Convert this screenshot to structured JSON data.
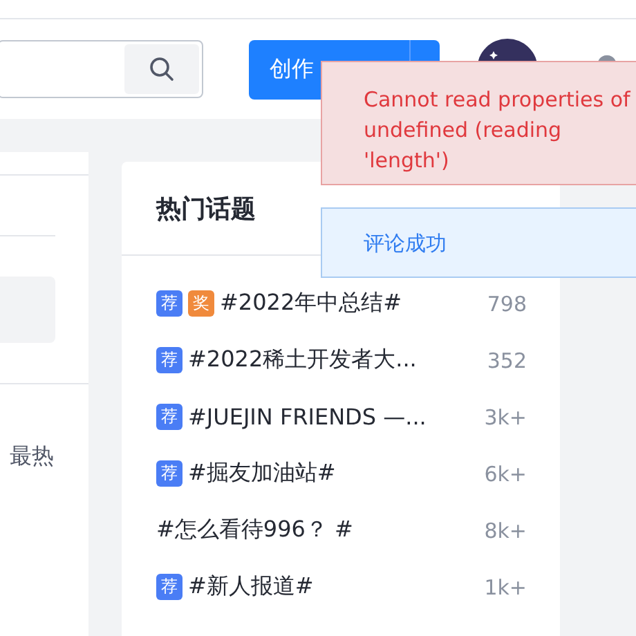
{
  "header": {
    "create_button": {
      "label": "创作"
    }
  },
  "left_panel": {
    "sort_option": "最热"
  },
  "hot_topics": {
    "title": "热门话题",
    "items": [
      {
        "tags": [
          {
            "kind": "recommend",
            "label": "荐"
          },
          {
            "kind": "award",
            "label": "奖"
          }
        ],
        "title": "#2022年中总结#",
        "count": "798"
      },
      {
        "tags": [
          {
            "kind": "recommend",
            "label": "荐"
          }
        ],
        "title": "#2022稀土开发者大...",
        "count": "352"
      },
      {
        "tags": [
          {
            "kind": "recommend",
            "label": "荐"
          }
        ],
        "title": "#JUEJIN FRIENDS —...",
        "count": "3k+"
      },
      {
        "tags": [
          {
            "kind": "recommend",
            "label": "荐"
          }
        ],
        "title": "#掘友加油站#",
        "count": "6k+"
      },
      {
        "title": "#怎么看待996？ #",
        "count": "8k+"
      },
      {
        "tags": [
          {
            "kind": "recommend",
            "label": "荐"
          }
        ],
        "title": "#新人报道#",
        "count": "1k+"
      }
    ]
  },
  "toasts": [
    {
      "kind": "error",
      "message": "Cannot read properties of undefined (reading 'length')"
    },
    {
      "kind": "success",
      "message": "评论成功"
    }
  ]
}
